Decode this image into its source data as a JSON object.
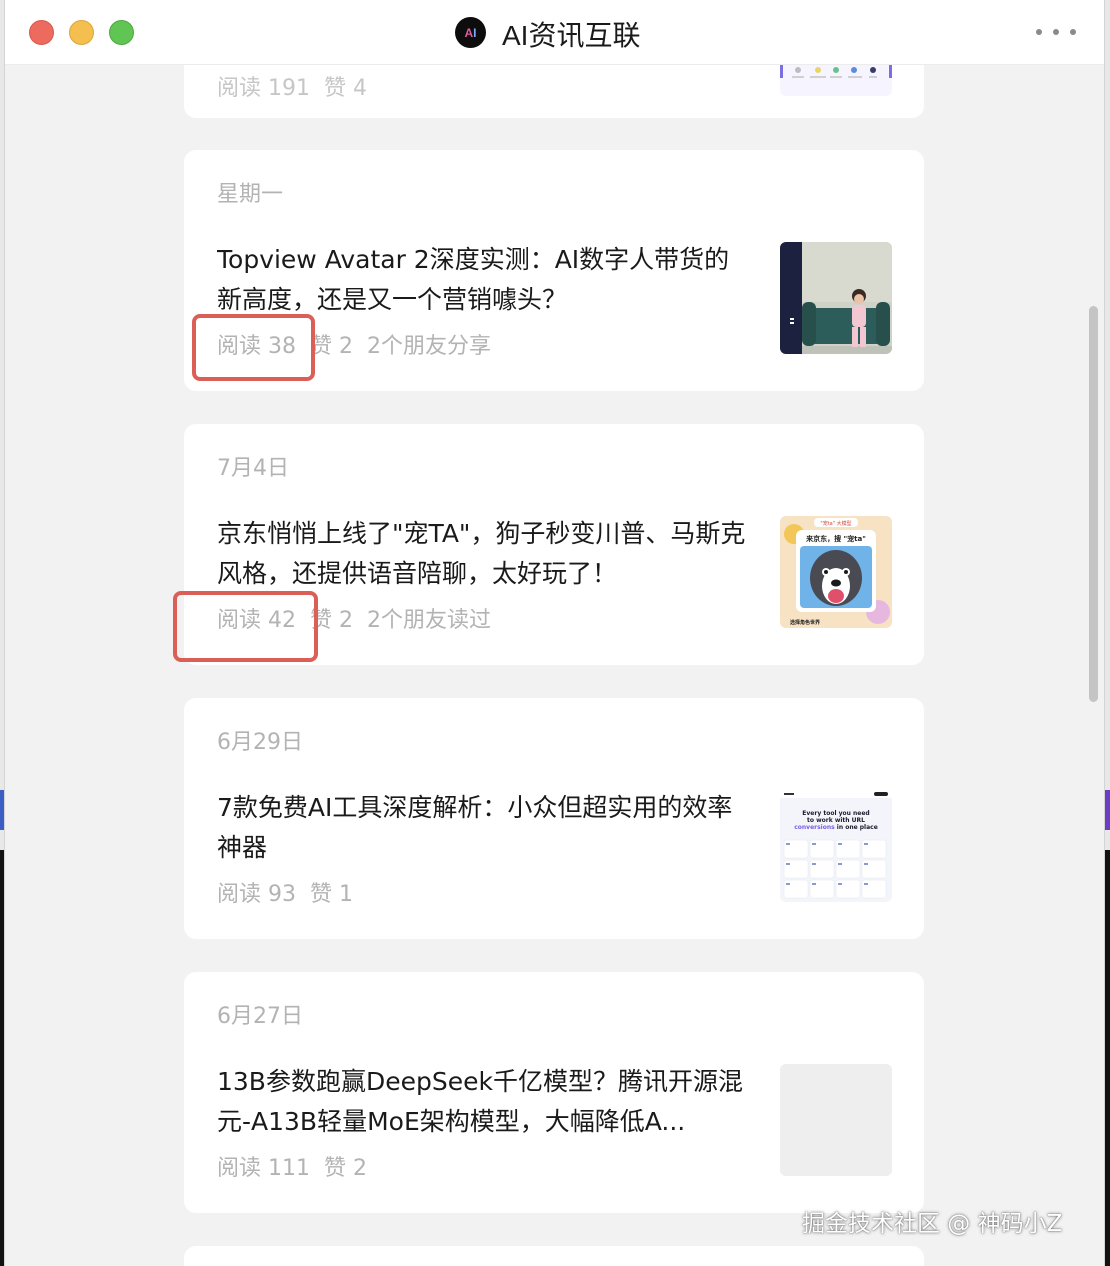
{
  "window": {
    "title": "AI资讯互联",
    "logo_text": "AI"
  },
  "articles": [
    {
      "date": "",
      "title": "",
      "reads": "阅读 191",
      "likes": "赞 4",
      "friends": "",
      "thumb": "tool-logos-thumbnail"
    },
    {
      "date": "星期一",
      "title": "Topview Avatar 2深度实测：AI数字人带货的新高度，还是又一个营销噱头？",
      "reads": "阅读 38",
      "likes": "赞 2",
      "friends": "2个朋友分享",
      "thumb": "avatar-woman-sofa-thumbnail"
    },
    {
      "date": "7月4日",
      "title": "京东悄悄上线了\"宠TA\"，狗子秒变川普、马斯克风格，还提供语音陪聊，太好玩了！",
      "reads": "阅读 42",
      "likes": "赞 2",
      "friends": "2个朋友读过",
      "thumb": "husky-dog-thumbnail",
      "thumb_text": {
        "badge": "\"宠ta\" 大模型",
        "headline": "来京东，搜 \"宠ta\"",
        "footer": "选择角色世界"
      }
    },
    {
      "date": "6月29日",
      "title": "7款免费AI工具深度解析：小众但超实用的效率神器",
      "reads": "阅读 93",
      "likes": "赞 1",
      "friends": "",
      "thumb": "url-tools-thumbnail",
      "thumb_text": {
        "line1": "Every tool you need",
        "line2": "to work with URL",
        "line3_accent": "conversions",
        "line3_rest": " in one place"
      }
    },
    {
      "date": "6月27日",
      "title": "13B参数跑赢DeepSeek千亿模型？腾讯开源混元-A13B轻量MoE架构模型，大幅降低A...",
      "reads": "阅读 111",
      "likes": "赞 2",
      "friends": "",
      "thumb": "blank-thumbnail"
    }
  ],
  "watermark": "掘金技术社区 @ 神码小Z",
  "colors": {
    "background": "#f2f2f2",
    "card": "#ffffff",
    "muted_text": "#b3b3b3",
    "highlight": "#dc5f57",
    "close": "#ed6a5e",
    "minimize": "#f5bf4f",
    "maximize": "#61c554"
  }
}
